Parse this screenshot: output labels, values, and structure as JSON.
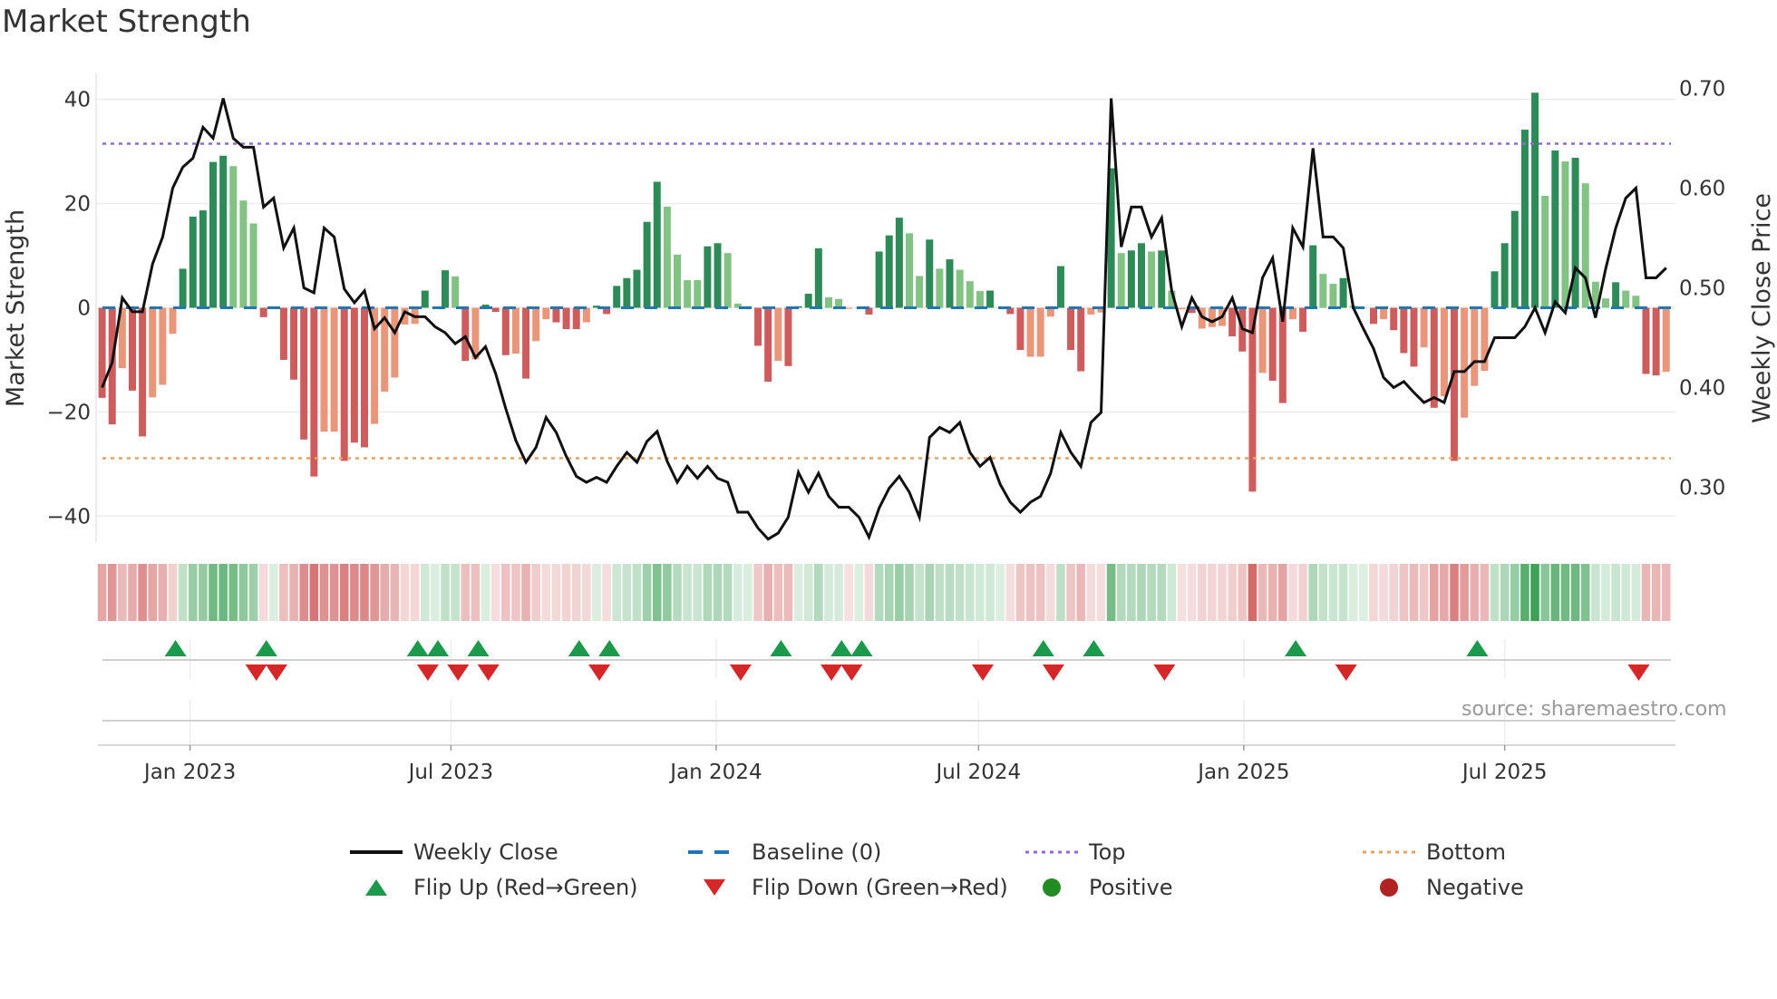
{
  "title": "Market Strength",
  "source": "source: sharemaestro.com",
  "legend": {
    "weekly_close": "Weekly Close",
    "baseline": "Baseline (0)",
    "top": "Top",
    "bottom": "Bottom",
    "flip_up": "Flip Up (Red→Green)",
    "flip_down": "Flip Down (Green→Red)",
    "positive": "Positive",
    "negative": "Negative"
  },
  "colors": {
    "strong_positive": "#2e8b57",
    "weak_positive": "#82c383",
    "strong_negative": "#cd5c5c",
    "weak_negative": "#e9967a",
    "price_line": "#111111",
    "baseline": "#1f77b4",
    "top": "#9467dd",
    "bottom": "#f0a060",
    "flip_up": "#1a9a4a",
    "flip_down": "#d62728",
    "positive": "#228b22",
    "negative": "#b22222"
  },
  "chart_data": {
    "type": "bar+line",
    "title": "Market Strength",
    "ylabel": "Market Strength",
    "y2label": "Weekly Close Price",
    "ylim": [
      -45,
      45
    ],
    "y2lim": [
      0.245,
      0.715
    ],
    "yticks": [
      "40",
      "20",
      "0",
      "−20",
      "−40"
    ],
    "ytick_values": [
      40,
      20,
      0,
      -20,
      -40
    ],
    "y2ticks": [
      "0.70",
      "0.60",
      "0.50",
      "0.40",
      "0.30"
    ],
    "y2tick_values": [
      0.7,
      0.6,
      0.5,
      0.4,
      0.3
    ],
    "xticks": [
      "Jan 2023",
      "Jul 2023",
      "Jan 2024",
      "Jul 2024",
      "Jan 2025",
      "Jul 2025"
    ],
    "xtick_dates": [
      "2023-01-01",
      "2023-07-01",
      "2024-01-01",
      "2024-07-01",
      "2025-01-01",
      "2025-07-01"
    ],
    "x_start": "2022-11-01",
    "x_step_days": 7,
    "top_level": 31.5,
    "bottom_level": -28.9,
    "baseline": 0,
    "strength": [
      -17.3,
      -22.4,
      -11.6,
      -15.9,
      -24.7,
      -17.2,
      -14.8,
      -5,
      7.5,
      17.5,
      18.7,
      28,
      29.2,
      27.2,
      20.6,
      16.2,
      -1.8,
      0,
      -10,
      -13.8,
      -25.3,
      -32.4,
      -23.8,
      -23.8,
      -29.4,
      -25.9,
      -26.8,
      -22.3,
      -16.1,
      -13.4,
      -3.2,
      -3.1,
      3.3,
      0,
      7.2,
      6,
      -10.2,
      -9.9,
      0.6,
      -0.8,
      -9.1,
      -8.8,
      -13.6,
      -6.4,
      -2.2,
      -2.8,
      -4.1,
      -4.1,
      -2.8,
      0.4,
      -1.2,
      4.2,
      5.7,
      7.3,
      16.5,
      24.2,
      19.4,
      10.2,
      5.3,
      5.3,
      11.8,
      12.4,
      10.5,
      0.8,
      0.3,
      -7.3,
      -14.2,
      -10.2,
      -11.2,
      0.3,
      2.7,
      11.4,
      2,
      1.7,
      -0.2,
      0,
      -1.3,
      10.8,
      13.9,
      17.3,
      14.3,
      6.1,
      13.1,
      7.5,
      9.3,
      7.3,
      5.1,
      3.2,
      3.3,
      0,
      -1.2,
      -8.1,
      -9.4,
      -9.4,
      -1.7,
      8,
      -8.1,
      -12.2,
      -1.3,
      -0.9,
      26.8,
      10.5,
      11,
      12.4,
      10.8,
      11,
      3.3,
      -0.3,
      -1,
      -4,
      -3.7,
      -3.5,
      -5.5,
      -8.4,
      -35.3,
      -12.5,
      -14,
      -18.3,
      -2.2,
      -4.6,
      12,
      6.5,
      4.6,
      5.7,
      0.4,
      0,
      -3.1,
      -2.2,
      -4.3,
      -8.7,
      -11.3,
      -7.6,
      -19.2,
      -17,
      -29.4,
      -21.1,
      -15,
      -12.1,
      7,
      12.4,
      18.6,
      34.2,
      41.3,
      21.5,
      30.2,
      28.1,
      28.8,
      23.9,
      5,
      1.8,
      4.9,
      3.3,
      2.3,
      -12.7,
      -13,
      -12.3
    ],
    "strong": [
      1,
      1,
      0,
      1,
      1,
      0,
      0,
      0,
      1,
      1,
      1,
      1,
      1,
      0,
      0,
      0,
      1,
      0,
      1,
      1,
      1,
      1,
      0,
      0,
      1,
      1,
      1,
      0,
      0,
      0,
      0,
      0,
      1,
      0,
      1,
      0,
      1,
      0,
      1,
      1,
      1,
      0,
      1,
      0,
      0,
      1,
      1,
      1,
      0,
      1,
      1,
      1,
      1,
      1,
      1,
      1,
      0,
      0,
      0,
      0,
      1,
      1,
      0,
      0,
      0,
      1,
      1,
      0,
      1,
      1,
      1,
      1,
      0,
      0,
      0,
      0,
      1,
      1,
      1,
      1,
      0,
      0,
      1,
      0,
      1,
      0,
      0,
      0,
      1,
      0,
      1,
      1,
      0,
      0,
      0,
      1,
      1,
      1,
      0,
      0,
      1,
      0,
      1,
      1,
      0,
      1,
      0,
      0,
      1,
      0,
      0,
      0,
      1,
      1,
      1,
      0,
      1,
      1,
      0,
      1,
      1,
      0,
      0,
      1,
      0,
      0,
      1,
      0,
      1,
      1,
      1,
      0,
      1,
      0,
      1,
      0,
      0,
      0,
      1,
      1,
      1,
      1,
      1,
      0,
      1,
      0,
      1,
      0,
      0,
      0,
      1,
      0,
      0,
      1,
      1,
      0
    ],
    "weekly_close": [
      0.4,
      0.425,
      0.49,
      0.476,
      0.476,
      0.524,
      0.551,
      0.6,
      0.621,
      0.63,
      0.661,
      0.65,
      0.69,
      0.65,
      0.641,
      0.641,
      0.581,
      0.59,
      0.54,
      0.56,
      0.5,
      0.495,
      0.56,
      0.551,
      0.499,
      0.485,
      0.497,
      0.459,
      0.47,
      0.455,
      0.476,
      0.471,
      0.471,
      0.461,
      0.455,
      0.444,
      0.451,
      0.43,
      0.441,
      0.414,
      0.379,
      0.347,
      0.325,
      0.34,
      0.37,
      0.355,
      0.331,
      0.311,
      0.305,
      0.31,
      0.305,
      0.321,
      0.335,
      0.325,
      0.346,
      0.356,
      0.326,
      0.305,
      0.321,
      0.309,
      0.321,
      0.309,
      0.305,
      0.275,
      0.275,
      0.259,
      0.248,
      0.254,
      0.27,
      0.315,
      0.295,
      0.314,
      0.291,
      0.28,
      0.28,
      0.27,
      0.25,
      0.279,
      0.299,
      0.311,
      0.295,
      0.27,
      0.35,
      0.36,
      0.355,
      0.365,
      0.335,
      0.321,
      0.33,
      0.303,
      0.285,
      0.275,
      0.285,
      0.291,
      0.314,
      0.355,
      0.335,
      0.321,
      0.365,
      0.375,
      0.69,
      0.541,
      0.581,
      0.581,
      0.551,
      0.57,
      0.497,
      0.461,
      0.49,
      0.471,
      0.466,
      0.471,
      0.49,
      0.459,
      0.455,
      0.51,
      0.53,
      0.466,
      0.56,
      0.541,
      0.64,
      0.551,
      0.551,
      0.54,
      0.48,
      0.459,
      0.439,
      0.41,
      0.4,
      0.406,
      0.395,
      0.385,
      0.39,
      0.385,
      0.416,
      0.416,
      0.426,
      0.426,
      0.45,
      0.45,
      0.45,
      0.461,
      0.48,
      0.455,
      0.486,
      0.475,
      0.52,
      0.51,
      0.47,
      0.519,
      0.56,
      0.59,
      0.6,
      0.51,
      0.51,
      0.52
    ],
    "flip_up_weeks": [
      8,
      17,
      32,
      34,
      38,
      48,
      51,
      68,
      74,
      76,
      94,
      99,
      119,
      137
    ],
    "flip_down_weeks": [
      16,
      18,
      33,
      36,
      39,
      50,
      64,
      73,
      75,
      88,
      95,
      106,
      124,
      153
    ],
    "grid": true,
    "legend_position": "bottom"
  }
}
